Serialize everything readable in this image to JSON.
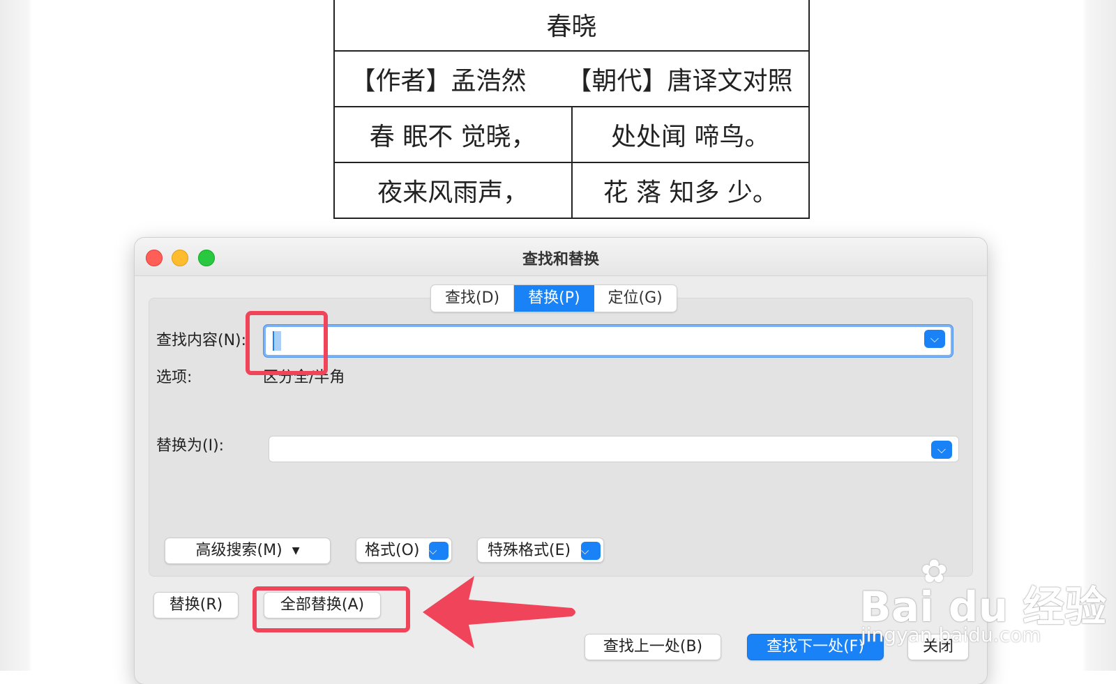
{
  "poem": {
    "title": "春晓",
    "author": "【作者】孟浩然",
    "dynasty": "【朝代】唐译文对照",
    "lines": [
      [
        "春  眠不  觉晓，",
        "处处闻  啼鸟。"
      ],
      [
        "夜来风雨声，",
        "花  落  知多  少。"
      ]
    ]
  },
  "dialog": {
    "title": "查找和替换",
    "tabs": [
      {
        "label": "查找(D)",
        "active": false
      },
      {
        "label": "替换(P)",
        "active": true
      },
      {
        "label": "定位(G)",
        "active": false
      }
    ],
    "find_label": "查找内容(N):",
    "find_value": "",
    "options_label": "选项:",
    "options_value": "区分全/半角",
    "replace_label": "替换为(I):",
    "replace_value": "",
    "advanced_search_label": "高级搜索(M)",
    "format_label": "格式(O)",
    "special_format_label": "特殊格式(E)",
    "replace_button": "替换(R)",
    "replace_all_button": "全部替换(A)",
    "find_prev_button": "查找上一处(B)",
    "find_next_button": "查找下一处(F)",
    "close_button": "关闭"
  },
  "watermark": {
    "brand": "Bai du 经验",
    "url": "jingyan.baidu.com"
  },
  "colors": {
    "accent": "#1a82f7",
    "highlight": "#f0445a",
    "traffic_close": "#ff5f57",
    "traffic_min": "#febc2e",
    "traffic_max": "#28c840"
  },
  "icons": {
    "dropdown": "chevron-down-icon",
    "advanced": "double-chevron-down-icon",
    "annotation": "arrow-left-icon"
  }
}
